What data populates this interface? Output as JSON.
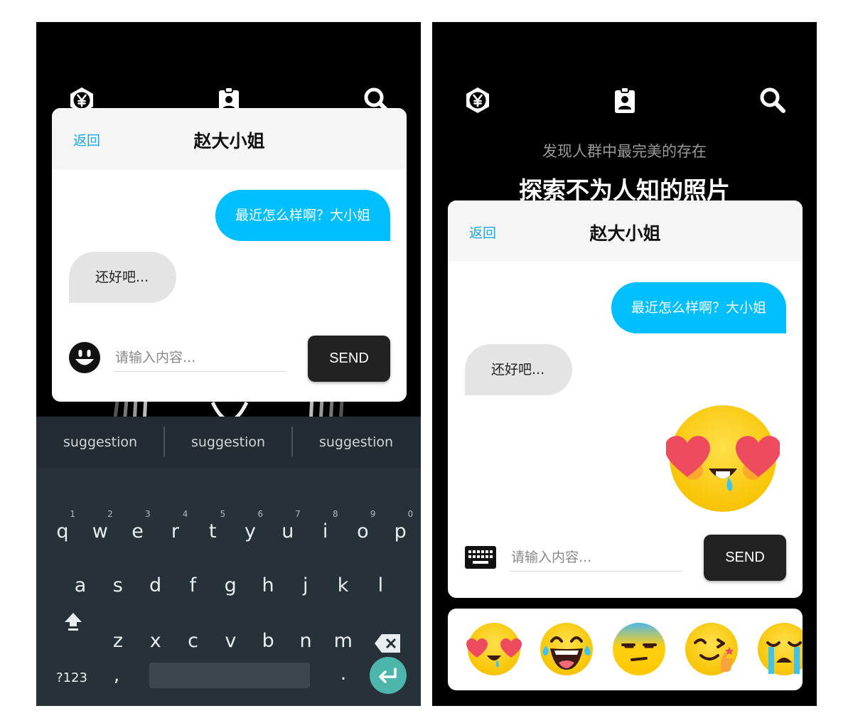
{
  "colors": {
    "accent_blue": "#00bfff",
    "link_blue": "#1ba8e0",
    "keyboard_bg": "#263238",
    "enter_key": "#4db6ac",
    "emoji_yellow": "#ffd012"
  },
  "top_icons": [
    "yen-hexagon-icon",
    "id-badge-icon",
    "search-icon"
  ],
  "chat": {
    "back_label": "返回",
    "title": "赵大小姐",
    "messages": [
      {
        "from": "me",
        "text": "最近怎么样啊？大小姐"
      },
      {
        "from": "other",
        "text": "还好吧..."
      }
    ],
    "input_placeholder": "请输入内容...",
    "send_label": "SEND"
  },
  "keyboard": {
    "suggestions": [
      "suggestion",
      "suggestion",
      "suggestion"
    ],
    "row1": [
      "q",
      "w",
      "e",
      "r",
      "t",
      "y",
      "u",
      "i",
      "o",
      "p"
    ],
    "row1_hints": [
      "1",
      "2",
      "3",
      "4",
      "5",
      "6",
      "7",
      "8",
      "9",
      "0"
    ],
    "row2": [
      "a",
      "s",
      "d",
      "f",
      "g",
      "h",
      "j",
      "k",
      "l"
    ],
    "row3": [
      "z",
      "x",
      "c",
      "v",
      "b",
      "n",
      "m"
    ],
    "symbols_label": "?123",
    "comma": ",",
    "period": "."
  },
  "right_screen": {
    "subtitle": "发现人群中最完美的存在",
    "title": "探索不为人知的照片",
    "sent_emoji": "heart-eyes-drool-emoji",
    "tray": [
      "heart-eyes-emoji",
      "tears-of-joy-emoji",
      "unamused-emoji",
      "wink-thumbs-up-emoji",
      "crying-emoji"
    ]
  }
}
